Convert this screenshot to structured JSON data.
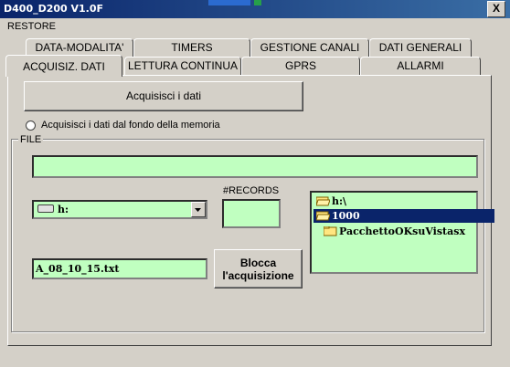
{
  "window": {
    "title": "D400_D200 V1.0F",
    "close_glyph": "X"
  },
  "menu": {
    "items": [
      "RESTORE"
    ]
  },
  "tabs": {
    "row_back": [
      "DATA-MODALITA'",
      "TIMERS",
      "GESTIONE CANALI",
      "DATI GENERALI"
    ],
    "row_front": [
      "ACQUISIZ. DATI",
      "LETTURA CONTINUA",
      "GPRS",
      "ALLARMI"
    ],
    "active": "ACQUISIZ. DATI"
  },
  "acquire_button": {
    "label": "Acquisisci i dati"
  },
  "from_end_option": {
    "label": "Acquisisci i dati dal fondo della memoria",
    "checked": false
  },
  "file_group": {
    "label": "FILE",
    "path_value": "",
    "drive_select": {
      "value": "h:"
    },
    "records_label": "#RECORDS",
    "records_value": "",
    "filename_value": "A_08_10_15.txt",
    "block_button": {
      "line1": "Blocca",
      "line2": "l'acquisizione"
    },
    "tree": [
      {
        "label": "h:\\",
        "icon": "open-folder-icon",
        "selected": false
      },
      {
        "label": "1000",
        "icon": "open-folder-icon",
        "selected": true
      },
      {
        "label": "PacchettoOKsuVistasx",
        "icon": "folder-icon",
        "selected": false
      }
    ]
  },
  "colors": {
    "field_bg": "#c0ffc0",
    "selection": "#0a246a",
    "window_bg": "#d4d0c8"
  }
}
